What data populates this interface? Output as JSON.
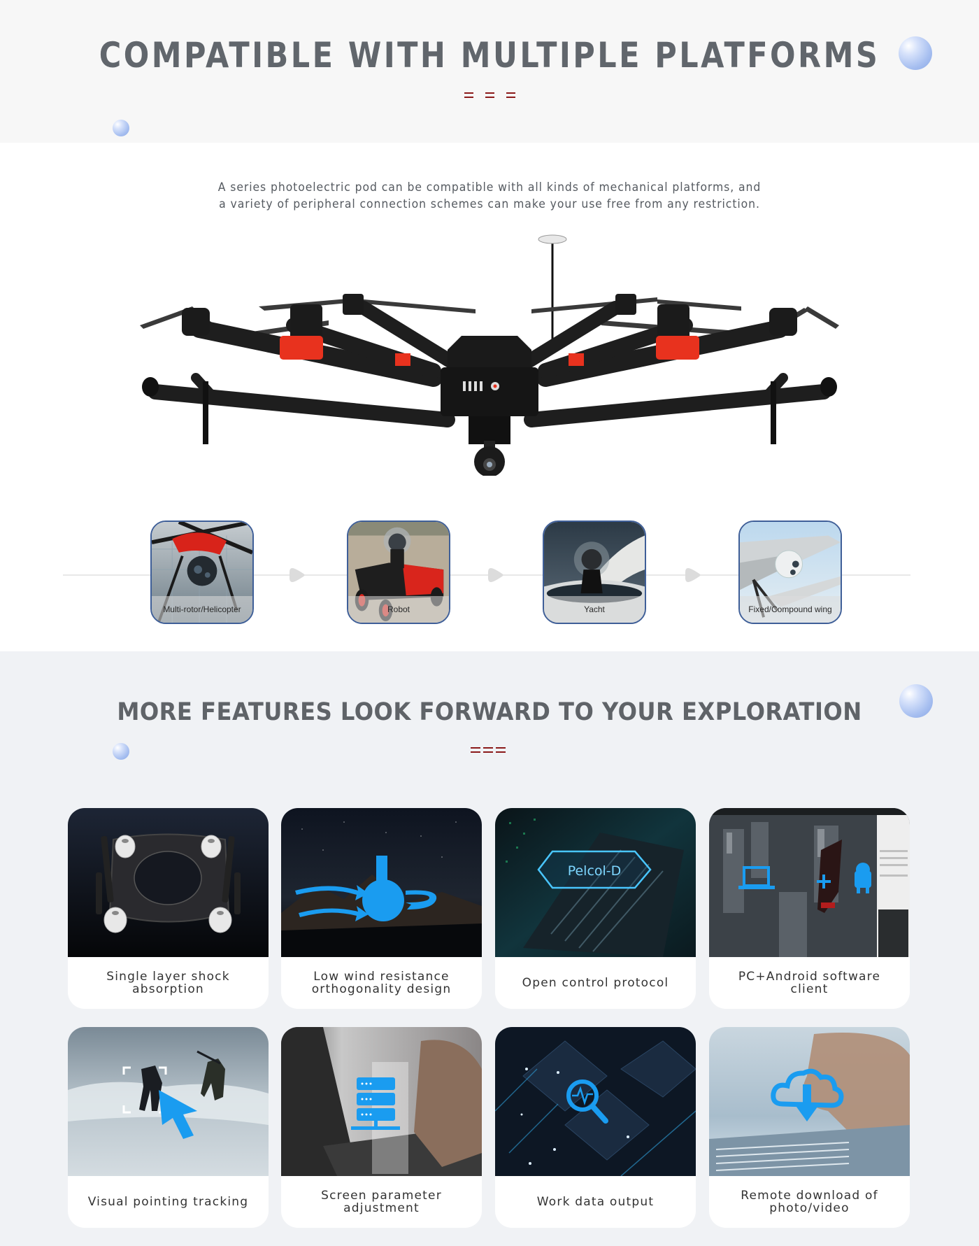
{
  "section1": {
    "title": "COMPATIBLE WITH MULTIPLE PLATFORMS",
    "subtitle_line1": "A series photoelectric pod can be compatible with all kinds of mechanical platforms, and",
    "subtitle_line2": "a variety of peripheral connection schemes can make your use free from any restriction.",
    "hero_image": "hexacopter-drone-with-gimbal-camera",
    "platforms": [
      {
        "label": "Multi-rotor/Helicopter",
        "icon": "drone-image"
      },
      {
        "label": "Robot",
        "icon": "robot-image"
      },
      {
        "label": "Yacht",
        "icon": "yacht-image"
      },
      {
        "label": "Fixed/Compound wing",
        "icon": "fixed-wing-image"
      }
    ]
  },
  "section2": {
    "title": "MORE FEATURES LOOK FORWARD TO YOUR EXPLORATION",
    "features": [
      {
        "label": "Single layer shock absorption",
        "icon": "shock-plate-image"
      },
      {
        "label": "Low wind resistance orthogonality design",
        "icon": "wind-gimbal-image"
      },
      {
        "label": "Open control protocol",
        "icon": "protocol-image",
        "overlay_text": "Pelcol-D"
      },
      {
        "label": "PC+Android software client",
        "icon": "software-client-image"
      },
      {
        "label": "Visual pointing tracking",
        "icon": "tracking-image"
      },
      {
        "label": "Screen parameter adjustment",
        "icon": "parameter-image"
      },
      {
        "label": "Work data output",
        "icon": "data-output-image"
      },
      {
        "label": "Remote download of photo/video",
        "icon": "cloud-download-image"
      }
    ]
  },
  "colors": {
    "title": "#61666c",
    "accent_dash": "#8b1a1a",
    "tile_border": "#3f5f98",
    "icon_blue": "#1a9cf0",
    "section2_bg": "#f0f2f5"
  }
}
